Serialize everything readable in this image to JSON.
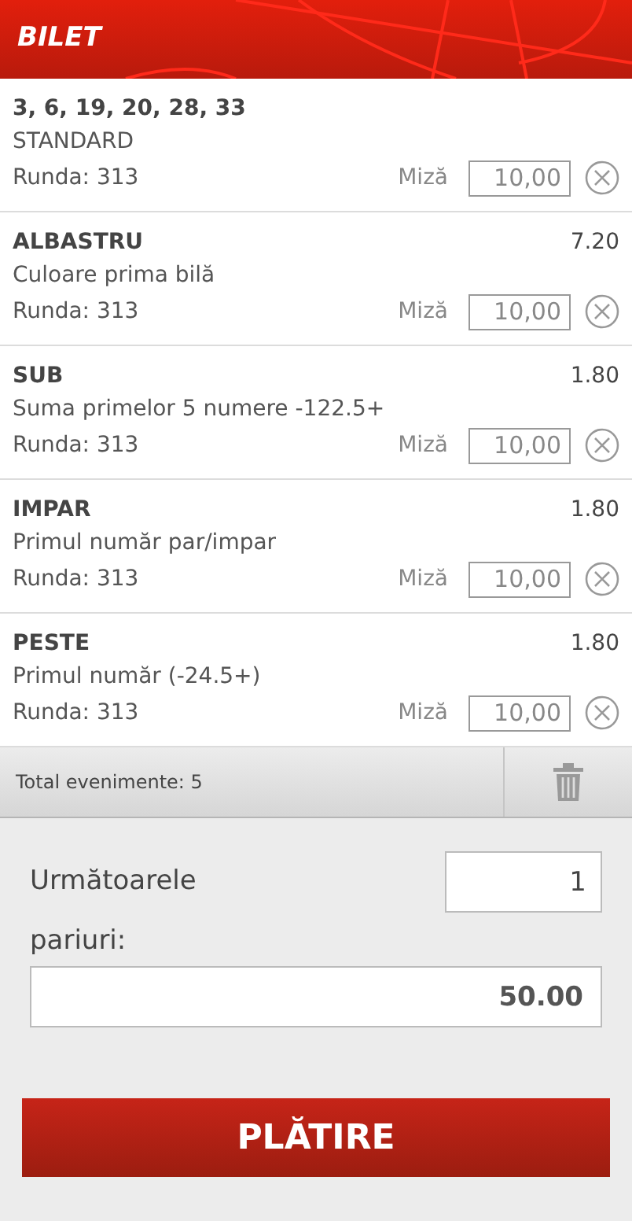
{
  "header": {
    "title": "BILET"
  },
  "bets": [
    {
      "title": "3, 6, 19, 20, 28, 33",
      "subtitle": "STANDARD",
      "round": "Runda: 313",
      "stake_label": "Miză",
      "stake": "10,00"
    },
    {
      "title": "ALBASTRU",
      "odds": "7.20",
      "subtitle": "Culoare prima bilă",
      "round": "Runda: 313",
      "stake_label": "Miză",
      "stake": "10,00"
    },
    {
      "title": "SUB",
      "odds": "1.80",
      "subtitle": "Suma primelor 5 numere -122.5+",
      "round": "Runda: 313",
      "stake_label": "Miză",
      "stake": "10,00"
    },
    {
      "title": "IMPAR",
      "odds": "1.80",
      "subtitle": "Primul număr par/impar",
      "round": "Runda: 313",
      "stake_label": "Miză",
      "stake": "10,00"
    },
    {
      "title": "PESTE",
      "odds": "1.80",
      "subtitle": "Primul număr (-24.5+)",
      "round": "Runda: 313",
      "stake_label": "Miză",
      "stake": "10,00"
    }
  ],
  "summary": {
    "total": "Total evenimente: 5"
  },
  "next_bets": {
    "label": "Următoarele pariuri:",
    "value": "1"
  },
  "amount": "50.00",
  "pay_button": "PLĂTIRE"
}
